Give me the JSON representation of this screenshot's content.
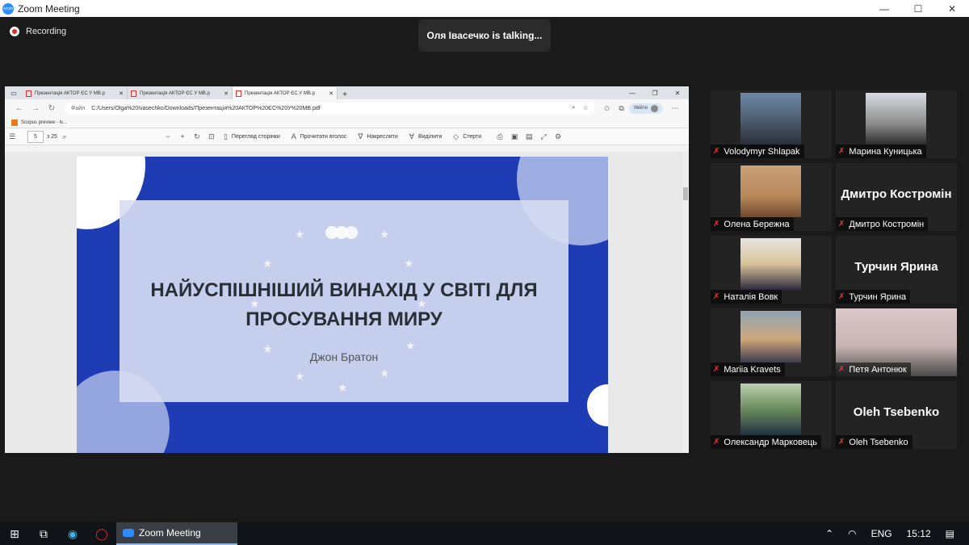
{
  "window": {
    "title": "Zoom Meeting",
    "controls": [
      "—",
      "☐",
      "✕"
    ]
  },
  "recording": {
    "label": "Recording"
  },
  "talking": {
    "text": "Оля Івасечко is talking..."
  },
  "browser": {
    "tabs": [
      {
        "label": "Презентація АКТОР ЄС У МВ.p",
        "active": false
      },
      {
        "label": "Презентація АКТОР ЄС У МВ.p",
        "active": false
      },
      {
        "label": "Презентація АКТОР ЄС У МВ.p",
        "active": true
      }
    ],
    "newtab": "+",
    "address": {
      "label": "Файл",
      "url": "C:/Users/Olga%20Ivasechko/Downloads/Презентація%20АКТОР%20ЄС%20У%20МВ.pdf"
    },
    "signin_label": "Увійти",
    "bookmark": "Scopus preview - lv...",
    "pdf": {
      "page": "5",
      "of_pages": "з 25",
      "tools": [
        "Перегляд сторінки",
        "Прочитати вголос",
        "Накреслити",
        "Виділити",
        "Стерти"
      ]
    },
    "slide": {
      "title_line1": "НАЙУСПІШНІШИЙ ВИНАХІД У СВІТІ ДЛЯ",
      "title_line2": "ПРОСУВАННЯ МИРУ",
      "author": "Джон Братон"
    }
  },
  "participants": [
    {
      "name": "Volodymyr Shlapak",
      "has_video": true
    },
    {
      "name": "Марина Куницька",
      "has_video": true
    },
    {
      "name": "Олена Бережна",
      "has_video": true
    },
    {
      "name": "Дмитро Костромін",
      "display": "Дмитро  Костромін",
      "has_video": false
    },
    {
      "name": "Наталія Вовк",
      "has_video": true
    },
    {
      "name": "Турчин Ярина",
      "display": "Турчин Ярина",
      "has_video": false
    },
    {
      "name": "Mariia Kravets",
      "has_video": true
    },
    {
      "name": "Петя Антонюк",
      "has_video": true
    },
    {
      "name": "Олександр Марковець",
      "has_video": true
    },
    {
      "name": "Oleh Tsebenko",
      "display": "Oleh Tsebenko",
      "has_video": false
    }
  ],
  "taskbar": {
    "zoom_label": "Zoom Meeting",
    "language": "ENG",
    "time": "15:12"
  },
  "colors": {
    "slide_blue": "#1e3db5",
    "mic_muted": "#e53935",
    "zoom_blue": "#2d8cff"
  }
}
